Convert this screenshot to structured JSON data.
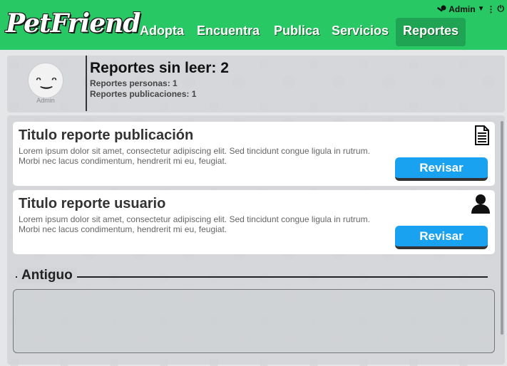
{
  "brand": {
    "name": "PetFriend"
  },
  "nav": {
    "items": [
      {
        "label": "Adopta"
      },
      {
        "label": "Encuentra"
      },
      {
        "label": "Publica"
      },
      {
        "label": "Servicios"
      },
      {
        "label": "Reportes"
      }
    ],
    "active_color": "#1fa454",
    "bar_color": "#28c864"
  },
  "user": {
    "name": "Admin",
    "avatar_label": "Admin",
    "avatar_face": "ᵔ‿ᵔ"
  },
  "summary": {
    "title": "Reportes sin leer: 2",
    "people": "Reportes personas: 1",
    "posts": "Reportes publicaciones: 1"
  },
  "reports": [
    {
      "title": "Titulo reporte publicación",
      "desc_line1": "Lorem ipsum dolor sit amet, consectetur adipiscing elit. Sed tincidunt congue ligula in rutrum.",
      "desc_line2": "Morbi nec lacus condimentum, hendrerit mi eu, feugiat.",
      "icon": "document-icon",
      "button": "Revisar"
    },
    {
      "title": "Titulo reporte usuario",
      "desc_line1": "Lorem ipsum dolor sit amet, consectetur adipiscing elit. Sed tincidunt congue ligula in rutrum.",
      "desc_line2": "Morbi nec lacus condimentum, hendrerit mi eu, feugiat.",
      "icon": "user-icon",
      "button": "Revisar"
    }
  ],
  "old_section": {
    "label": "Antiguo"
  },
  "colors": {
    "button": "#18a2f0"
  }
}
